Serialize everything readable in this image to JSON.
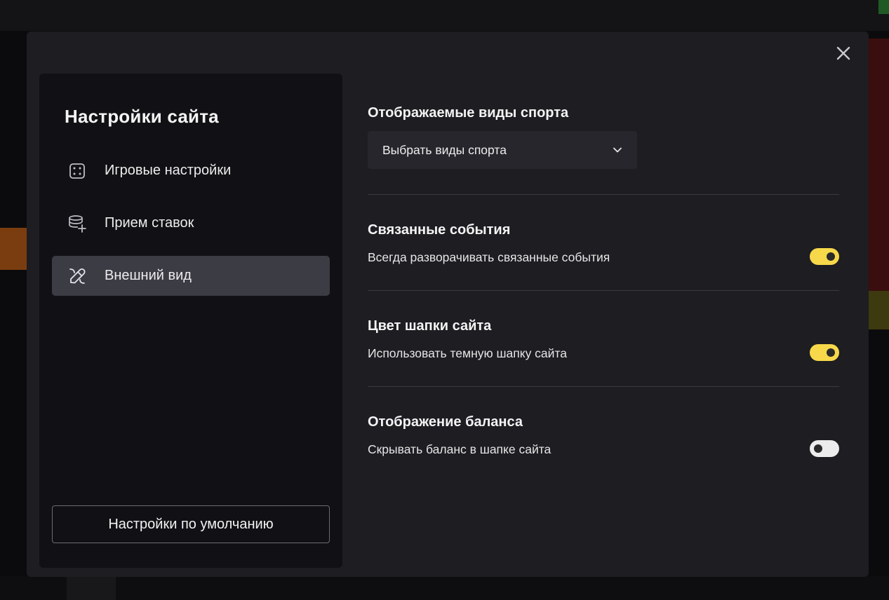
{
  "modal": {
    "sidebar": {
      "title": "Настройки сайта",
      "items": [
        {
          "label": "Игровые настройки",
          "icon": "dice-icon",
          "active": false
        },
        {
          "label": "Прием ставок",
          "icon": "coins-plus-icon",
          "active": false
        },
        {
          "label": "Внешний вид",
          "icon": "paint-brush-icon",
          "active": true
        }
      ],
      "reset_label": "Настройки по умолчанию"
    },
    "sections": {
      "sports": {
        "title": "Отображаемые виды спорта",
        "select_value": "Выбрать виды спорта"
      },
      "related": {
        "title": "Связанные события",
        "description": "Всегда разворачивать связанные события",
        "enabled": true
      },
      "header_color": {
        "title": "Цвет шапки сайта",
        "description": "Использовать темную шапку сайта",
        "enabled": true
      },
      "balance": {
        "title": "Отображение баланса",
        "description": "Скрывать баланс в шапке сайта",
        "enabled": false
      }
    }
  },
  "colors": {
    "accent": "#f7d84a",
    "modal_bg": "#1d1d22",
    "sidebar_bg": "#111115",
    "active_item_bg": "#3c3c45"
  }
}
